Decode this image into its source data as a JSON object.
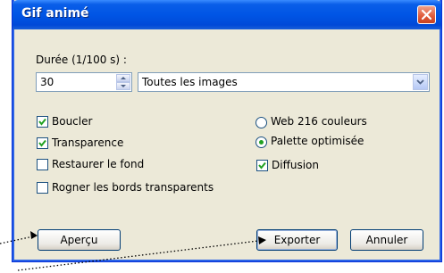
{
  "window": {
    "title": "Gif animé"
  },
  "duration": {
    "label": "Durée (1/100 s) :",
    "value": "30",
    "scope_selected": "Toutes les images"
  },
  "options": {
    "loop": {
      "label": "Boucler",
      "checked": true
    },
    "transparency": {
      "label": "Transparence",
      "checked": true
    },
    "restore_bg": {
      "label": "Restaurer le fond",
      "checked": false
    },
    "crop_edges": {
      "label": "Rogner les bords transparents",
      "checked": false
    }
  },
  "palette": {
    "web216": {
      "label": "Web 216 couleurs",
      "selected": false
    },
    "optimized": {
      "label": "Palette optimisée",
      "selected": true
    },
    "diffusion": {
      "label": "Diffusion",
      "checked": true
    }
  },
  "buttons": {
    "preview": "Aperçu",
    "export": "Exporter",
    "cancel": "Annuler"
  },
  "colors": {
    "titlebar": "#0055e5",
    "dialog_bg": "#ece9d8",
    "close": "#e05a3a"
  }
}
